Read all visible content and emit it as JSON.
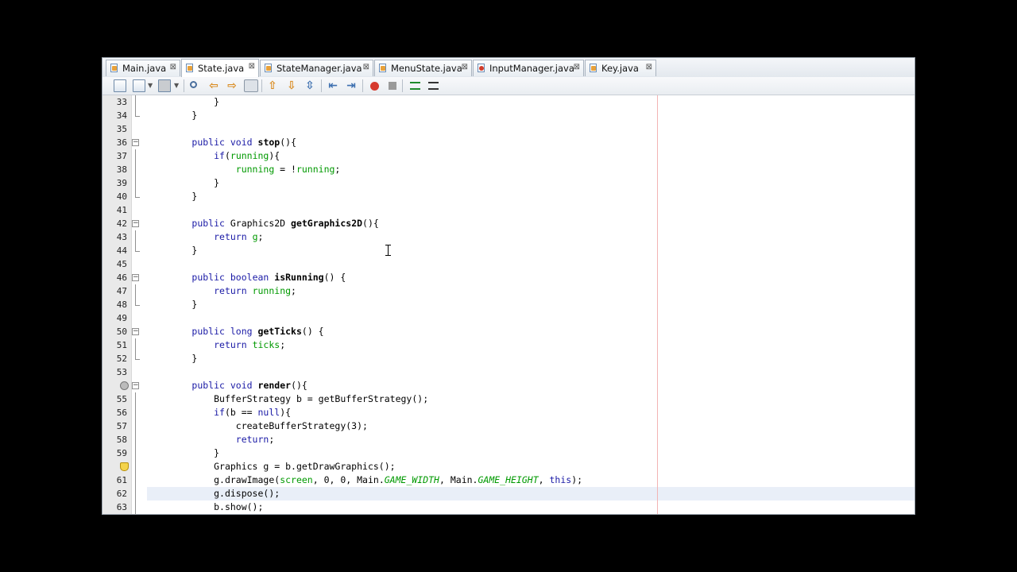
{
  "tabs": [
    {
      "label": "Main.java",
      "close": "⊠",
      "active": false,
      "error": false
    },
    {
      "label": "State.java",
      "close": "⊠",
      "active": true,
      "error": false
    },
    {
      "label": "StateManager.java",
      "close": "⊠",
      "active": false,
      "error": false
    },
    {
      "label": "MenuState.java",
      "close": "⊠",
      "active": false,
      "error": false
    },
    {
      "label": "InputManager.java",
      "close": "⊠",
      "active": false,
      "error": true
    },
    {
      "label": "Key.java",
      "close": "⊠",
      "active": false,
      "error": false
    }
  ],
  "toolbar_icons": [
    "last-edit-icon",
    "back-icon",
    "forward-icon",
    "find-icon",
    "find-previous-icon",
    "find-next-icon",
    "toggle-highlight-icon",
    "previous-bookmark-icon",
    "next-bookmark-icon",
    "toggle-bookmark-icon",
    "shift-left-icon",
    "shift-right-icon",
    "start-macro-recording-icon",
    "stop-macro-recording-icon",
    "comment-icon",
    "uncomment-icon"
  ],
  "code": {
    "l33": {
      "num": "33",
      "t1": "}"
    },
    "l34": {
      "num": "34",
      "t1": "}"
    },
    "l35": {
      "num": "35"
    },
    "l36": {
      "num": "36",
      "kw1": "public",
      "kw2": "void",
      "name": "stop",
      "rest": "(){"
    },
    "l37": {
      "num": "37",
      "kw1": "if",
      "p1": "(",
      "f1": "running",
      "p2": "){"
    },
    "l38": {
      "num": "38",
      "f1": "running",
      "p1": " = !",
      "f2": "running",
      "p2": ";"
    },
    "l39": {
      "num": "39",
      "t1": "}"
    },
    "l40": {
      "num": "40",
      "t1": "}"
    },
    "l41": {
      "num": "41"
    },
    "l42": {
      "num": "42",
      "kw1": "public",
      "t1": " Graphics2D ",
      "name": "getGraphics2D",
      "rest": "(){"
    },
    "l43": {
      "num": "43",
      "kw1": "return",
      "f1": "g",
      "p1": ";"
    },
    "l44": {
      "num": "44",
      "t1": "}"
    },
    "l45": {
      "num": "45"
    },
    "l46": {
      "num": "46",
      "kw1": "public",
      "kw2": "boolean",
      "name": "isRunning",
      "rest": "() {"
    },
    "l47": {
      "num": "47",
      "kw1": "return",
      "f1": "running",
      "p1": ";"
    },
    "l48": {
      "num": "48",
      "t1": "}"
    },
    "l49": {
      "num": "49"
    },
    "l50": {
      "num": "50",
      "kw1": "public",
      "kw2": "long",
      "name": "getTicks",
      "rest": "() {"
    },
    "l51": {
      "num": "51",
      "kw1": "return",
      "f1": "ticks",
      "p1": ";"
    },
    "l52": {
      "num": "52",
      "t1": "}"
    },
    "l53": {
      "num": "53"
    },
    "l54": {
      "num": "",
      "kw1": "public",
      "kw2": "void",
      "name": "render",
      "rest": "(){"
    },
    "l55": {
      "num": "55",
      "t1": "BufferStrategy b = getBufferStrategy();"
    },
    "l56": {
      "num": "56",
      "kw1": "if",
      "p1": "(b == ",
      "kw2": "null",
      "p2": "){"
    },
    "l57": {
      "num": "57",
      "t1": "createBufferStrategy(3);"
    },
    "l58": {
      "num": "58",
      "kw1": "return",
      "p1": ";"
    },
    "l59": {
      "num": "59",
      "t1": "}"
    },
    "l60": {
      "num": "",
      "t1": "Graphics g = b.getDrawGraphics();"
    },
    "l61": {
      "num": "61",
      "t1": "g.drawImage(",
      "f1": "screen",
      "t2": ", 0, 0, Main.",
      "s1": "GAME_WIDTH",
      "t3": ", Main.",
      "s2": "GAME_HEIGHT",
      "t4": ", ",
      "kw1": "this",
      "t5": ");"
    },
    "l62": {
      "num": "62",
      "t1": "g.dispose();"
    },
    "l63": {
      "num": "63",
      "t1": "b.show();"
    }
  },
  "colors": {
    "keyword": "#1a1aa6",
    "field": "#009900",
    "margin_line": "#f2b4b4",
    "current_line": "#e9eff8"
  }
}
